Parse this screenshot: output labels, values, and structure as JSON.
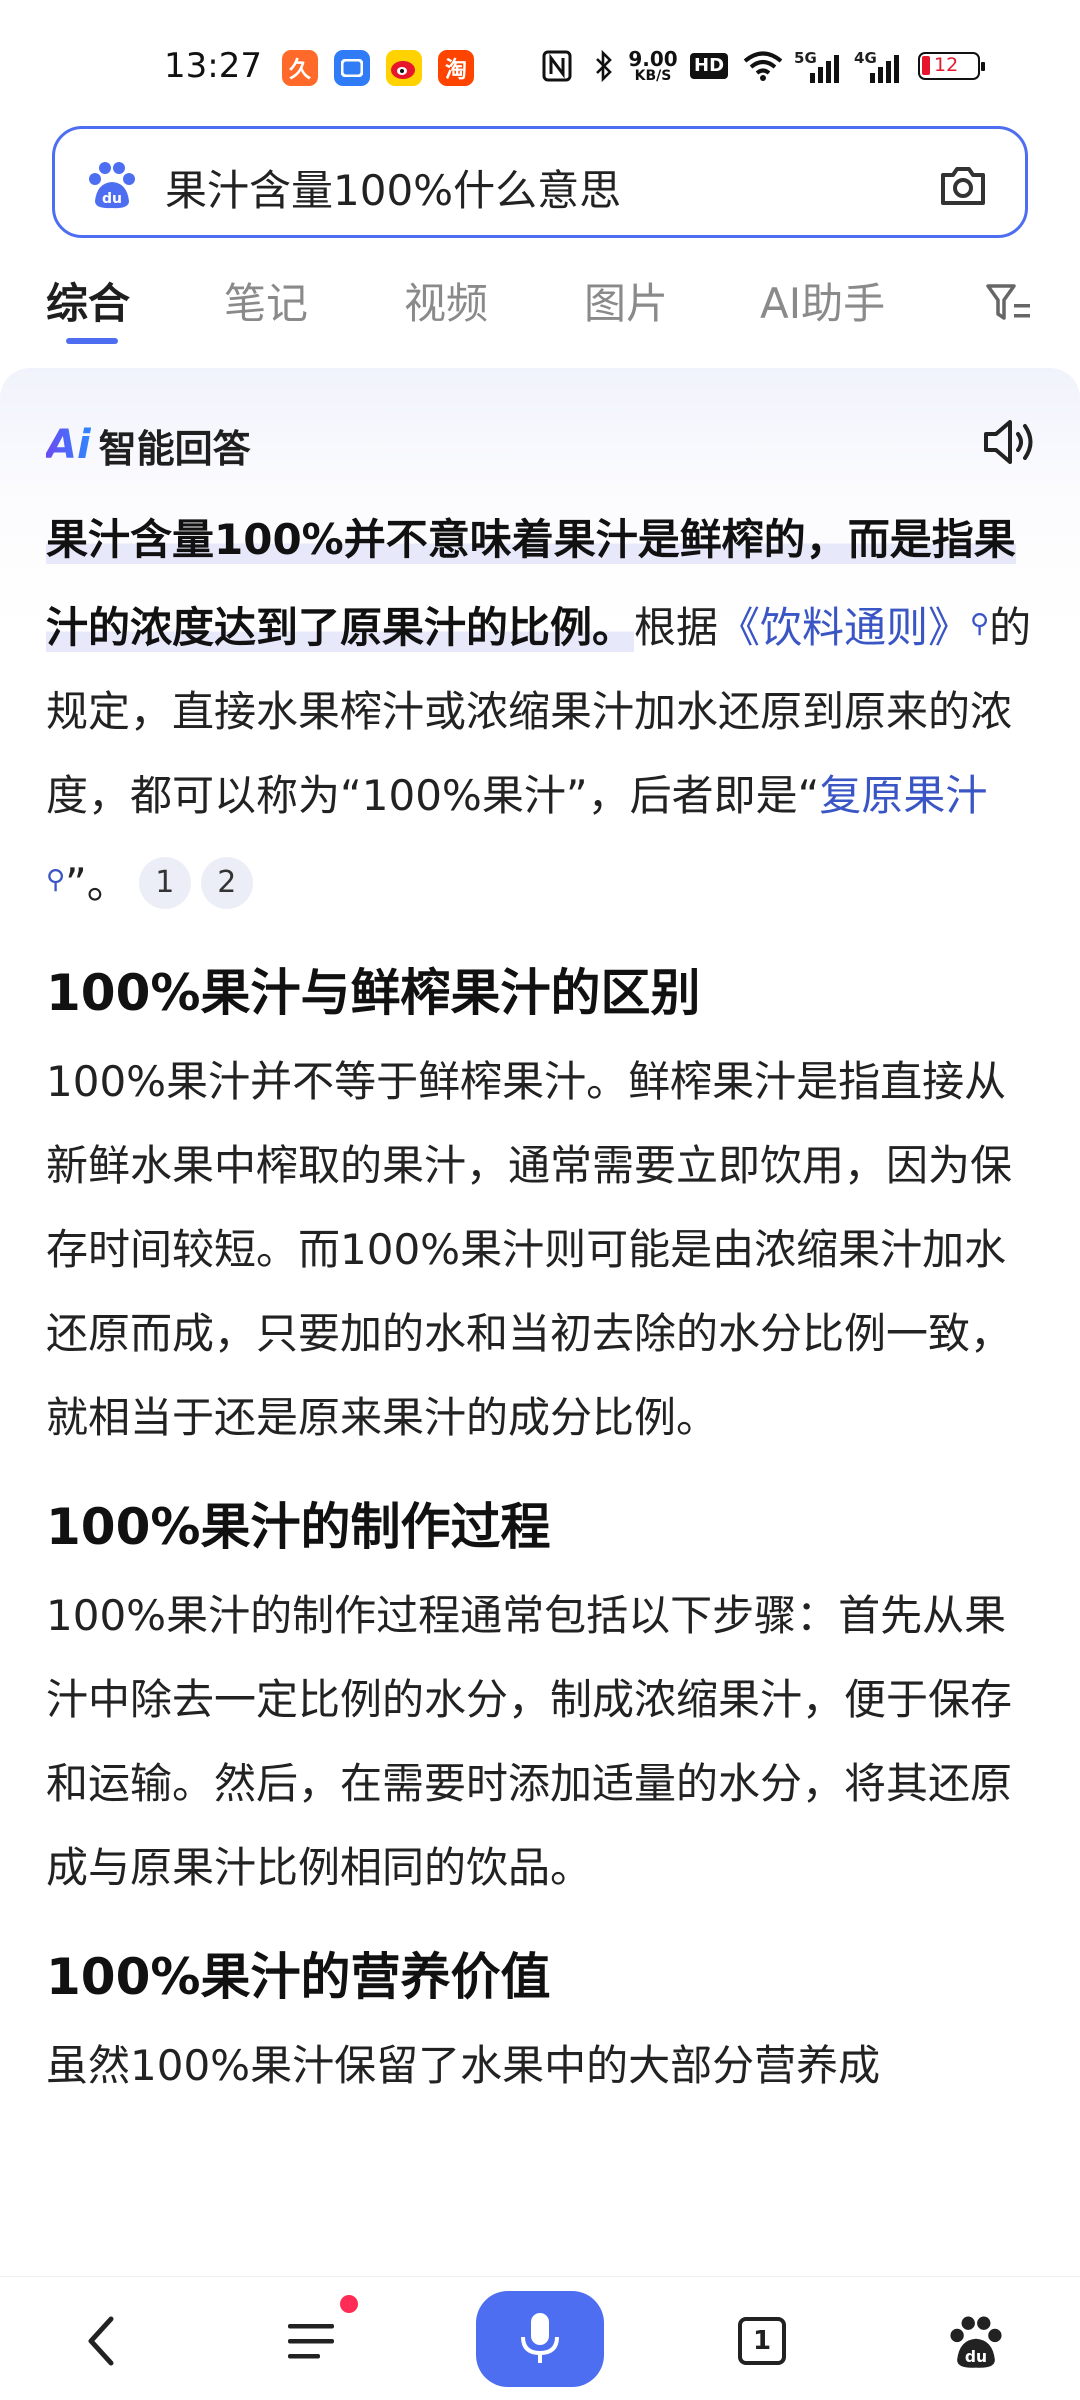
{
  "status_bar": {
    "time": "13:27",
    "speed_value": "9.00",
    "speed_unit": "KB/S",
    "hd_label": "HD",
    "net1": "5G",
    "net2": "4G",
    "battery": "12",
    "app_icons": [
      "job-app-icon",
      "message-app-icon",
      "weibo-icon",
      "taobao-icon"
    ]
  },
  "search": {
    "query": "果汁含量100%什么意思"
  },
  "tabs": {
    "items": [
      "综合",
      "笔记",
      "视频",
      "图片",
      "AI助手"
    ],
    "active_index": 0
  },
  "ai_card": {
    "logo": "Ai",
    "title": "智能回答",
    "intro_bold_1": "果汁含量100%并不意味着果汁是鲜榨的，而是指果汁的浓度达到了原果汁的比例。",
    "intro_text_1": "根据",
    "intro_link_1": "《饮料通则》",
    "intro_text_2": "的规定，直接水果榨汁或浓缩果汁加水还原到原来的浓度，都可以称为“100%果汁”，后者即是“",
    "intro_link_2": "复原果汁",
    "intro_text_3": "”。",
    "ref_1": "1",
    "ref_2": "2",
    "section_1_title": "100%果汁与鲜榨果汁的区别",
    "section_1_text": "100%果汁并不等于鲜榨果汁。鲜榨果汁是指直接从新鲜水果中榨取的果汁，通常需要立即饮用，因为保存时间较短。而100%果汁则可能是由浓缩果汁加水还原而成，只要加的水和当初去除的水分比例一致，就相当于还是原来果汁的成分比例。",
    "section_2_title": "100%果汁的制作过程",
    "section_2_text": "100%果汁的制作过程通常包括以下步骤：首先从果汁中除去一定比例的水分，制成浓缩果汁，便于保存和运输。然后，在需要时添加适量的水分，将其还原成与原果汁比例相同的饮品。",
    "section_3_title": "100%果汁的营养价值",
    "section_3_text": "虽然100%果汁保留了水果中的大部分营养成"
  },
  "bottom_nav": {
    "tab_count": "1"
  },
  "colors": {
    "accent": "#4e6ef2",
    "link": "#3a55c4",
    "badge": "#ff2d55"
  }
}
